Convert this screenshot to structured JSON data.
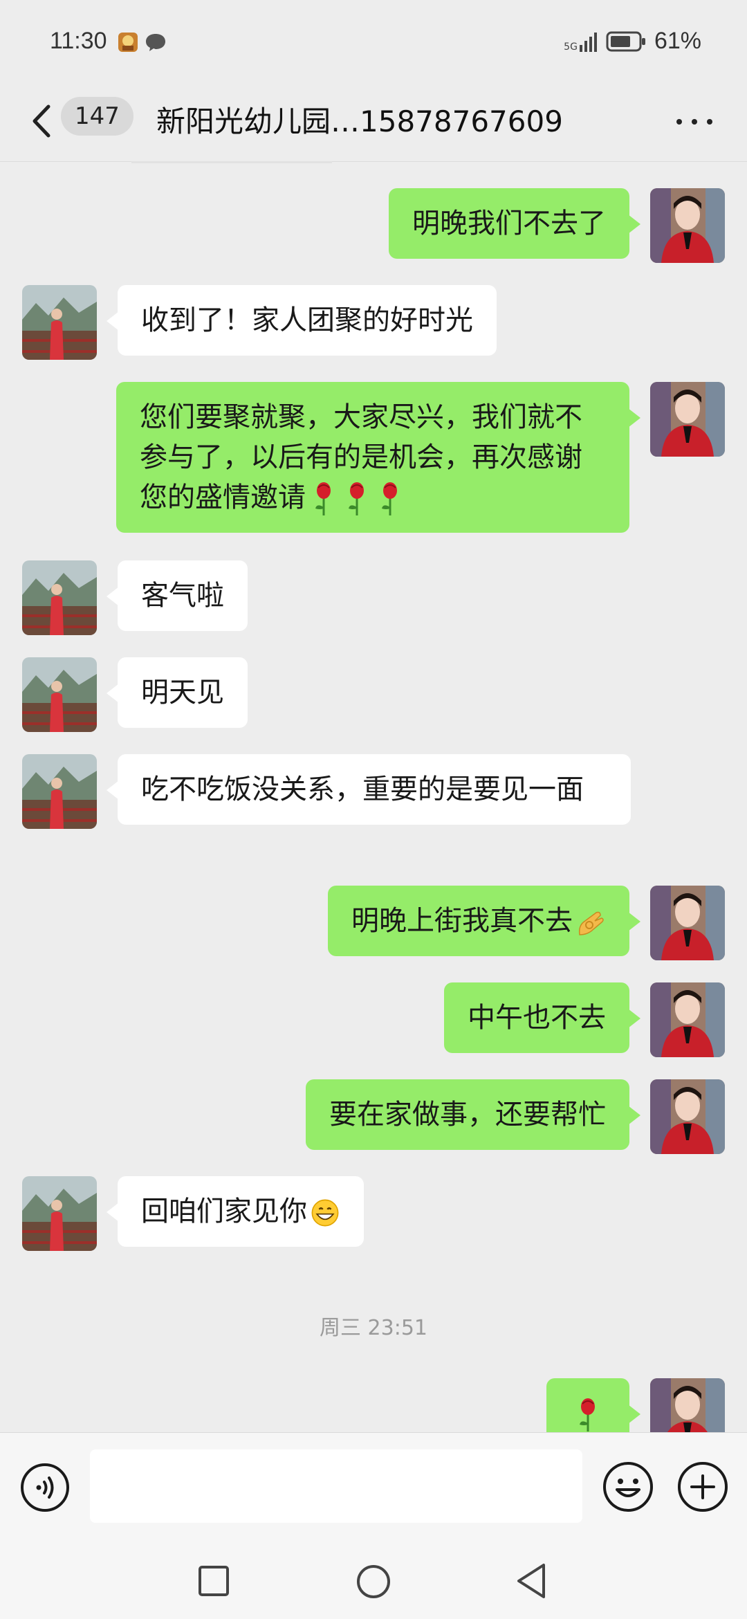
{
  "status_bar": {
    "time": "11:30",
    "network": "5G",
    "battery": "61%"
  },
  "header": {
    "unread_count": "147",
    "title": "新阳光幼儿园…15878767609"
  },
  "messages": [
    {
      "side": "me",
      "text": "明晚我们不去了"
    },
    {
      "side": "them",
      "text": "收到了！家人团聚的好时光"
    },
    {
      "side": "me",
      "text": "您们要聚就聚，大家尽兴，我们就不参与了，以后有的是机会，再次感谢您的盛情邀请",
      "emoji": "rose-emoji x3"
    },
    {
      "side": "them",
      "text": "客气啦"
    },
    {
      "side": "them",
      "text": "明天见"
    },
    {
      "side": "them",
      "text": "吃不吃饭没关系，重要的是要见一面"
    },
    {
      "side": "me",
      "text": "明晚上街我真不去",
      "emoji": "ok-hand-emoji"
    },
    {
      "side": "me",
      "text": "中午也不去"
    },
    {
      "side": "me",
      "text": "要在家做事，还要帮忙"
    },
    {
      "side": "them",
      "text": "回咱们家见你",
      "emoji": "grinning-emoji"
    },
    {
      "side": "me",
      "text": "",
      "emoji": "rose-emoji"
    }
  ],
  "timestamp": "周三 23:51",
  "input": {
    "value": "",
    "placeholder": ""
  },
  "colors": {
    "background": "#ededed",
    "my_bubble": "#95ec69",
    "their_bubble": "#ffffff"
  },
  "icons": [
    "back-arrow-icon",
    "more-icon",
    "voice-icon",
    "emoji-icon",
    "plus-icon",
    "nav-recent-icon",
    "nav-home-icon",
    "nav-back-icon"
  ]
}
